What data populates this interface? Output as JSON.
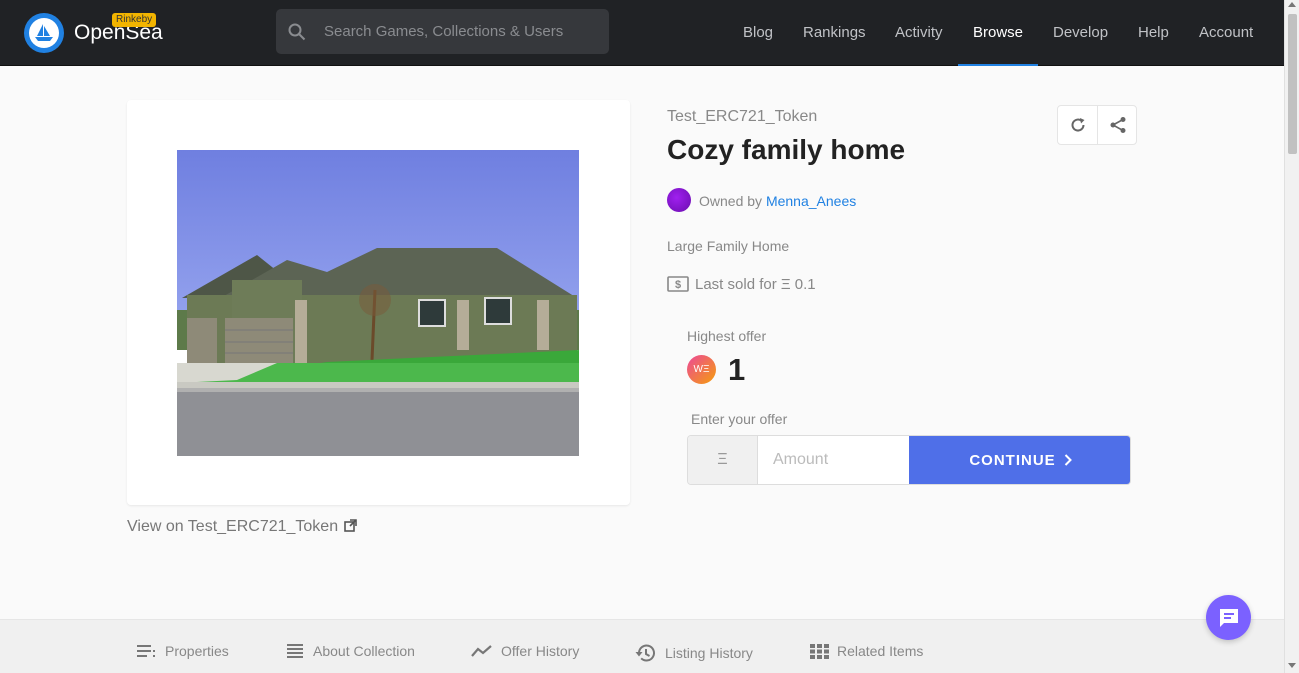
{
  "header": {
    "brand": "OpenSea",
    "network_badge": "Rinkeby",
    "search_placeholder": "Search Games, Collections & Users",
    "nav": [
      "Blog",
      "Rankings",
      "Activity",
      "Browse",
      "Develop",
      "Help",
      "Account"
    ],
    "active_nav": "Browse",
    "accent_color": "#2081e2"
  },
  "item": {
    "collection": "Test_ERC721_Token",
    "title": "Cozy family home",
    "owned_by_prefix": "Owned by",
    "owner": "Menna_Anees",
    "description": "Large Family Home",
    "last_sold": "Last sold for Ξ 0.1",
    "view_on": "View on Test_ERC721_Token"
  },
  "offer": {
    "highest_label": "Highest offer",
    "token_icon_text": "WΞ",
    "highest_value": "1",
    "enter_label": "Enter your offer",
    "currency_symbol": "Ξ",
    "amount_placeholder": "Amount",
    "continue_label": "CONTINUE",
    "button_color": "#4f6fe8"
  },
  "tabs": [
    "Properties",
    "About Collection",
    "Offer History",
    "Listing History",
    "Related Items"
  ]
}
